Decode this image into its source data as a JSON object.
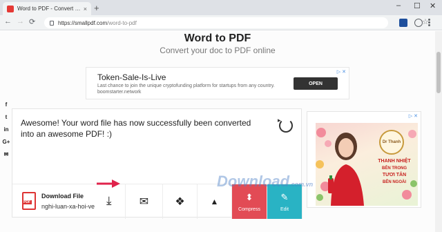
{
  "browser": {
    "tab_title": "Word to PDF - Convert your DO",
    "tab_close": "×",
    "new_tab": "+",
    "window_controls": [
      "–",
      "☐",
      "✕"
    ],
    "url_domain": "https://smallpdf.com",
    "url_path": "/word-to-pdf",
    "nav": [
      "←",
      "→",
      "⟳"
    ],
    "star": "☆"
  },
  "page": {
    "title": "Word to PDF",
    "subtitle": "Convert your doc to PDF online"
  },
  "ad_top": {
    "title": "Token-Sale-Is-Live",
    "description": "Last chance to join the unique cryptofunding platform for startups from any country. boomstarter.network",
    "button": "OPEN",
    "badge": "▷ ✕"
  },
  "social": [
    "f",
    "t",
    "in",
    "G+",
    "✉"
  ],
  "result": {
    "message": "Awesome! Your word file has now successfully been converted into an awesome PDF! :)",
    "download_title": "Download File",
    "file_name": "nghi-luan-xa-hoi-ve",
    "pdf_label": "PDF",
    "download_glyph": "⤓",
    "mail_glyph": "✉",
    "dropbox_glyph": "❖",
    "drive_glyph": "▲",
    "compress_label": "Compress",
    "edit_label": "Edit"
  },
  "ad_side": {
    "badge": "▷ ✕",
    "brand": "Dr Thanh",
    "slogan_1": "THANH NHIỆT",
    "slogan_2": "BÊN TRONG",
    "slogan_3": "TƯƠI TẮN",
    "slogan_4": "BÊN NGOÀI"
  },
  "watermark": {
    "text": "Download",
    "suffix": ".com.vn"
  },
  "colors": {
    "compress": "#e24b55",
    "edit": "#29b3c4",
    "pdf_red": "#dd3333"
  }
}
